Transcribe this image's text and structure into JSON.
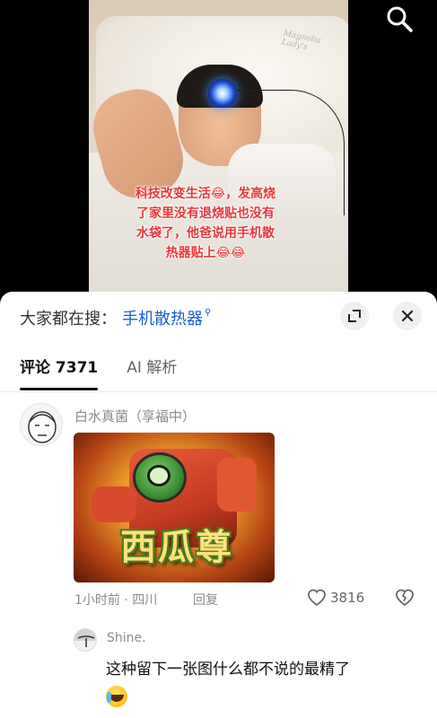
{
  "video": {
    "pillow_brand": "Magnolia Lady's",
    "caption": "科技改变生活😂，发高烧了家里没有退烧贴也没有水袋了，他爸说用手机散热器贴上😂😂"
  },
  "search_bar": {
    "prefix": "大家都在搜：",
    "term": "手机散热器",
    "term_icon": "search-small-icon"
  },
  "buttons": {
    "expand_icon": "expand-icon",
    "close_icon": "close-icon",
    "top_search_icon": "search-icon"
  },
  "tabs": [
    {
      "label": "评论 7371",
      "active": true
    },
    {
      "label": "AI 解析",
      "active": false
    }
  ],
  "comment": {
    "username": "白水真菌（享福中）",
    "image_text": "西瓜尊",
    "meta": "1小时前 · 四川",
    "reply_label": "回复",
    "like_count": "3816"
  },
  "reply": {
    "username": "Shine.",
    "text": "这种留下一张图什么都不说的最精了"
  },
  "colors": {
    "accent_blue": "#1d5ecf",
    "caption_red": "#e8373a"
  }
}
